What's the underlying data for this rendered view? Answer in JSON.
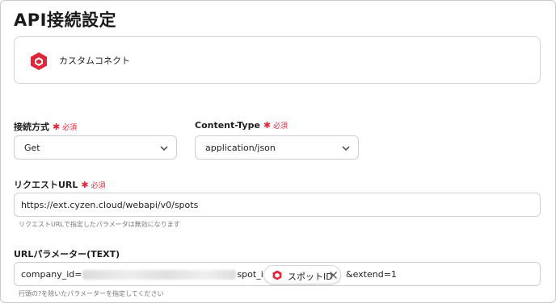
{
  "page": {
    "title": "API接続設定"
  },
  "connector": {
    "name": "カスタムコネクト",
    "logo": "red-hexagon-logo-icon",
    "brand_color": "#e0263a"
  },
  "required_label": "必須",
  "fields": {
    "connection_method": {
      "label": "接続方式",
      "value": "Get"
    },
    "content_type": {
      "label": "Content-Type",
      "value": "application/json"
    },
    "request_url": {
      "label": "リクエストURL",
      "value": "https://ext.cyzen.cloud/webapi/v0/spots",
      "hint": "リクエストURLで指定したパラメータは無効になります"
    },
    "url_params": {
      "label": "URLパラメーター(TEXT)",
      "part1": "company_id=",
      "part2": "spot_id=",
      "chip_label": "スポットID",
      "part3": "&extend=1",
      "hint": "行頭の?を除いたパラメーターを指定してください"
    }
  },
  "colors": {
    "required": "#e0263a",
    "border": "#cfcfcf",
    "text": "#222222"
  }
}
